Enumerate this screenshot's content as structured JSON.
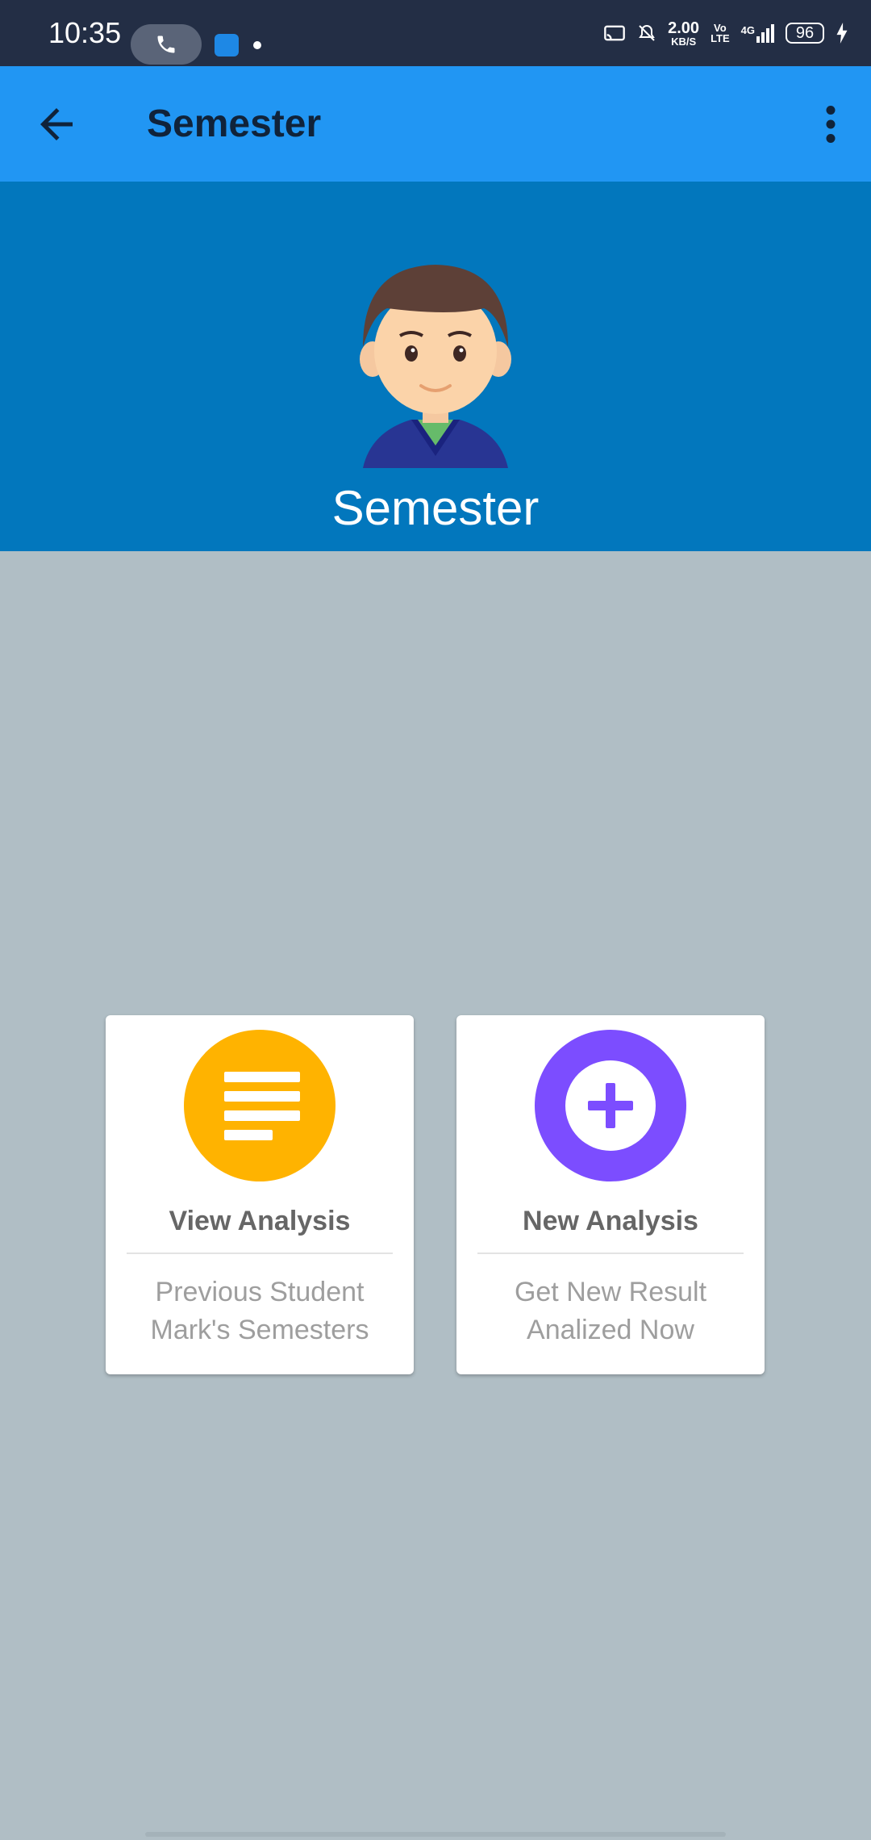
{
  "status_bar": {
    "time": "10:35",
    "net_speed_value": "2.00",
    "net_speed_unit": "KB/S",
    "volte_top": "Vo",
    "volte_bottom": "LTE",
    "network": "4G",
    "battery": "96"
  },
  "app_bar": {
    "title": "Semester"
  },
  "header": {
    "name": "Semester"
  },
  "cards": [
    {
      "title": "View Analysis",
      "subtitle_line1": "Previous Student",
      "subtitle_line2": "Mark's Semesters",
      "icon": "list-icon",
      "color": "#FFB300"
    },
    {
      "title": "New Analysis",
      "subtitle_line1": "Get New Result",
      "subtitle_line2": "Analized Now",
      "icon": "add-icon",
      "color": "#7C4DFF"
    }
  ],
  "colors": {
    "status_bar": "#232E45",
    "app_bar": "#2196F3",
    "header": "#0277BD",
    "background": "#B0BEC5"
  }
}
